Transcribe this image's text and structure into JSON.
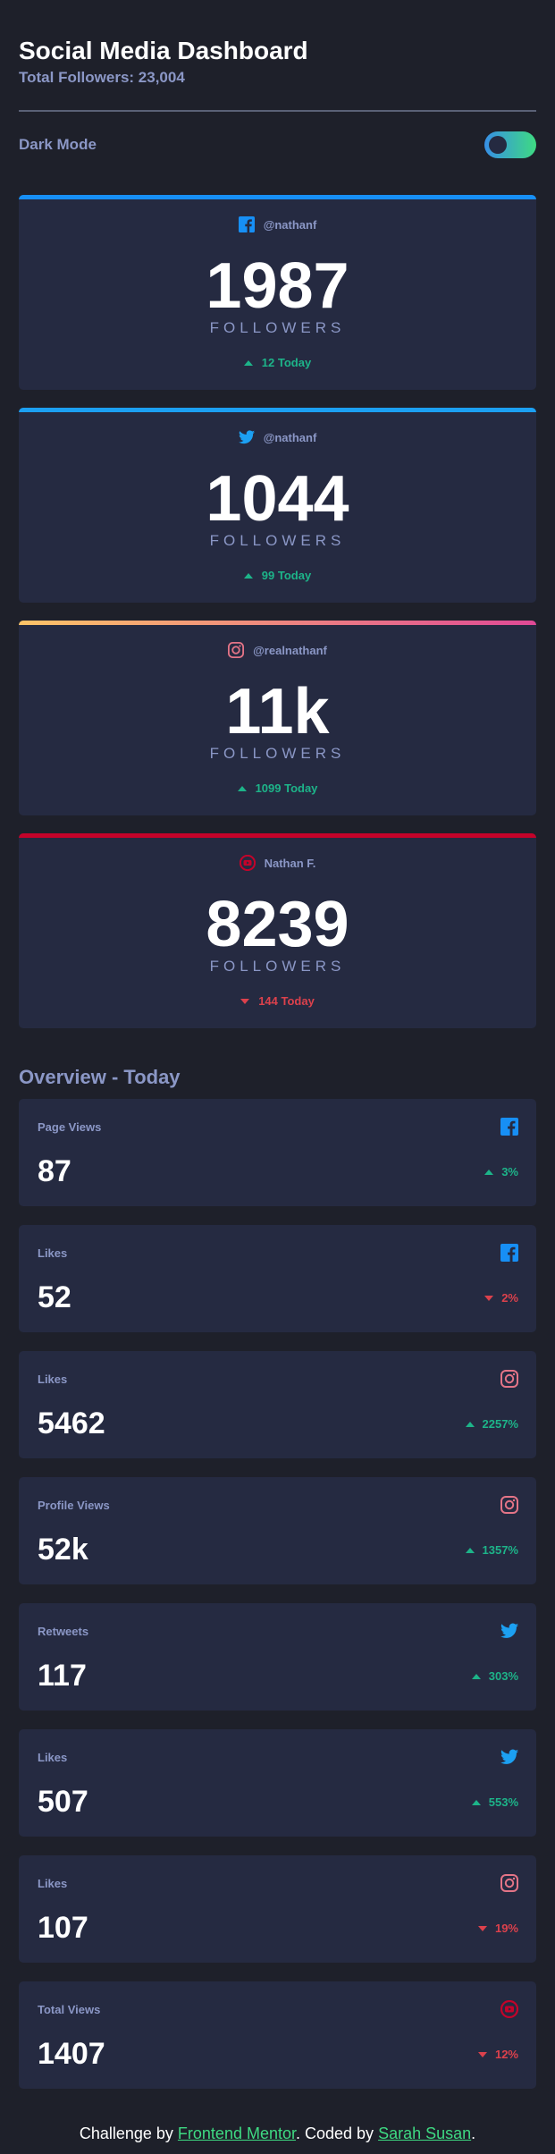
{
  "header": {
    "title": "Social Media Dashboard",
    "total_followers": "Total Followers: 23,004"
  },
  "mode": {
    "label": "Dark Mode",
    "enabled": true
  },
  "colors": {
    "facebook": "#178ff5",
    "twitter": "#1ca0f2",
    "instagram_start": "#fdc468",
    "instagram_end": "#df4996",
    "youtube": "#c4032a",
    "up": "#1db489",
    "down": "#dc414c",
    "toggle_start": "#378fe6",
    "toggle_end": "#3eda82"
  },
  "cards": [
    {
      "platform": "facebook",
      "icon": "facebook-icon",
      "handle": "@nathanf",
      "count": "1987",
      "label": "FOLLOWERS",
      "change": "12 Today",
      "trend": "up"
    },
    {
      "platform": "twitter",
      "icon": "twitter-icon",
      "handle": "@nathanf",
      "count": "1044",
      "label": "FOLLOWERS",
      "change": "99 Today",
      "trend": "up"
    },
    {
      "platform": "instagram",
      "icon": "instagram-icon",
      "handle": "@realnathanf",
      "count": "11k",
      "label": "FOLLOWERS",
      "change": "1099 Today",
      "trend": "up"
    },
    {
      "platform": "youtube",
      "icon": "youtube-icon",
      "handle": "Nathan F.",
      "count": "8239",
      "label": "FOLLOWERS",
      "change": "144 Today",
      "trend": "down"
    }
  ],
  "overview": {
    "title": "Overview - Today",
    "items": [
      {
        "label": "Page Views",
        "icon": "facebook-icon",
        "value": "87",
        "change": "3%",
        "trend": "up"
      },
      {
        "label": "Likes",
        "icon": "facebook-icon",
        "value": "52",
        "change": "2%",
        "trend": "down"
      },
      {
        "label": "Likes",
        "icon": "instagram-icon",
        "value": "5462",
        "change": "2257%",
        "trend": "up"
      },
      {
        "label": "Profile Views",
        "icon": "instagram-icon",
        "value": "52k",
        "change": "1357%",
        "trend": "up"
      },
      {
        "label": "Retweets",
        "icon": "twitter-icon",
        "value": "117",
        "change": "303%",
        "trend": "up"
      },
      {
        "label": "Likes",
        "icon": "twitter-icon",
        "value": "507",
        "change": "553%",
        "trend": "up"
      },
      {
        "label": "Likes",
        "icon": "instagram-icon",
        "value": "107",
        "change": "19%",
        "trend": "down"
      },
      {
        "label": "Total Views",
        "icon": "youtube-icon",
        "value": "1407",
        "change": "12%",
        "trend": "down"
      }
    ]
  },
  "footer": {
    "prefix": "Challenge by ",
    "link1": "Frontend Mentor",
    "middle": ". Coded by ",
    "link2": "Sarah Susan",
    "suffix": "."
  }
}
